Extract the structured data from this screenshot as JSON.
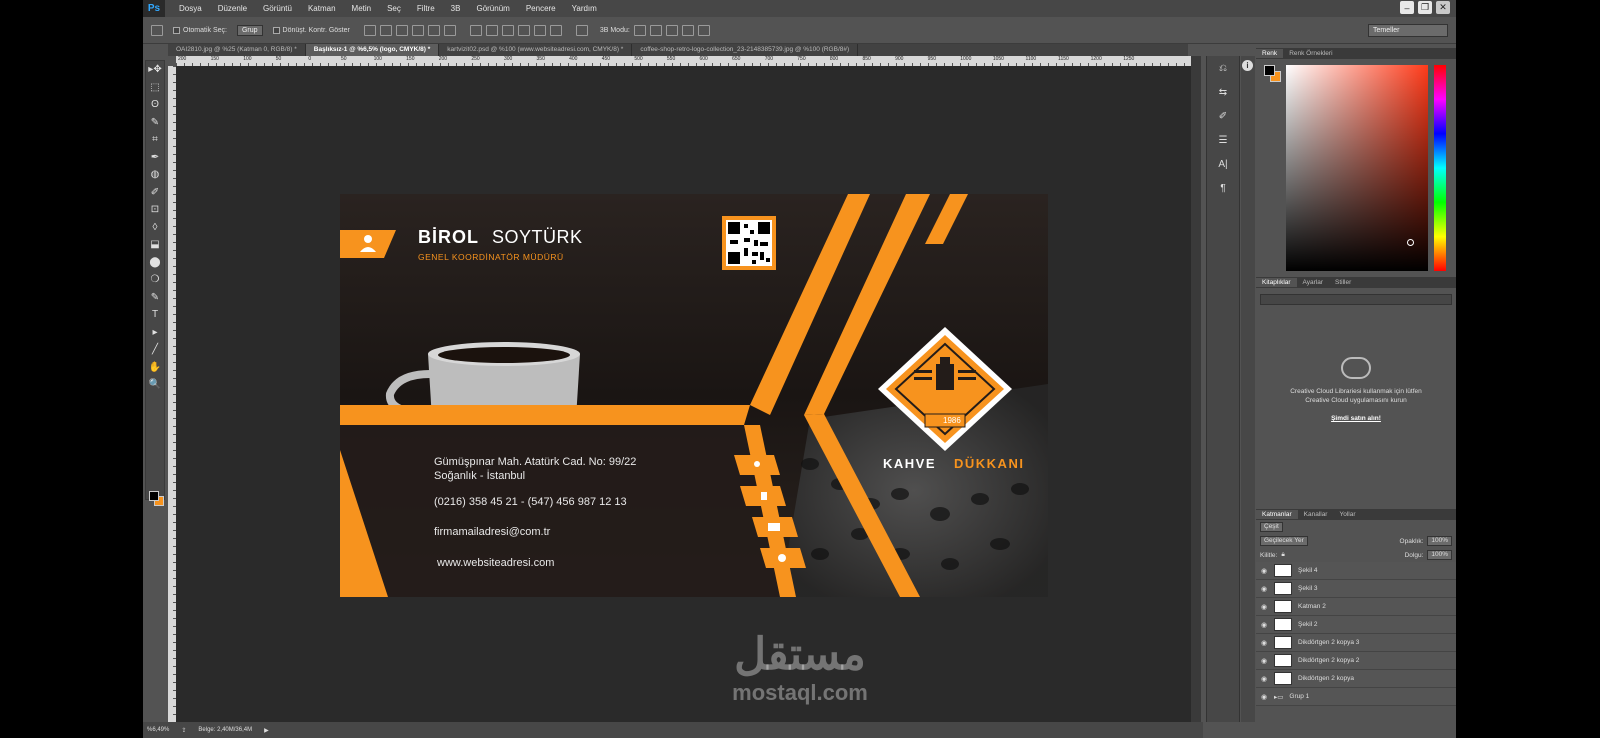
{
  "app": {
    "logo": "Ps"
  },
  "menu": [
    "Dosya",
    "Düzenle",
    "Görüntü",
    "Katman",
    "Metin",
    "Seç",
    "Filtre",
    "3B",
    "Görünüm",
    "Pencere",
    "Yardım"
  ],
  "options": {
    "auto_select_label": "Otomatik Seç:",
    "auto_select_value": "Grup",
    "transform_label": "Dönüşt. Kontr. Göster",
    "mode_3d": "3B Modu:",
    "workspace": "Temeller"
  },
  "tabs": [
    {
      "label": "OAI2810.jpg @ %25 (Katman 0, RGB/8) *",
      "active": false
    },
    {
      "label": "Başlıksız-1 @ %6,5% (logo, CMYK/8) *",
      "active": true
    },
    {
      "label": "kartvizit02.psd @ %100 (www.websiteadresi.com, CMYK/8) *",
      "active": false
    },
    {
      "label": "coffee-shop-retro-logo-collection_23-2148385739.jpg @ %100 (RGB/8#)",
      "active": false
    }
  ],
  "ruler_ticks": [
    "200",
    "150",
    "100",
    "50",
    "0",
    "50",
    "100",
    "150",
    "200",
    "250",
    "300",
    "350",
    "400",
    "450",
    "500",
    "550",
    "600",
    "650",
    "700",
    "750",
    "800",
    "850",
    "900",
    "950",
    "1000",
    "1050",
    "1100",
    "1150",
    "1200",
    "1250"
  ],
  "tools": [
    "▸✥",
    "⬚",
    "ʘ",
    "✎",
    "⌗",
    "✒",
    "◍",
    "✐",
    "⊡",
    "◊",
    "⬓",
    "⬤",
    "❍",
    "✎",
    "T",
    "▸",
    "╱",
    "✋",
    "🔍"
  ],
  "status": {
    "zoom": "%6,49%",
    "doc": "Belge: 2,40M/36,4M"
  },
  "card": {
    "name_first": "BİROL",
    "name_last": "SOYTÜRK",
    "job_title": "GENEL KOORDİNATÖR MÜDÜRÜ",
    "address_line1": "Gümüşpınar Mah. Atatürk Cad. No: 99/22",
    "address_line2": "Soğanlık - İstanbul",
    "phone": "(0216) 358 45 21 - (547) 456 987 12 13",
    "email": "firmamailadresi@com.tr",
    "website": "www.websiteadresi.com",
    "brand_1": "KAHVE",
    "brand_2": "DÜKKANI",
    "logo_year": "1986",
    "accent_color": "#f7931e"
  },
  "panels": {
    "color_tabs": [
      "Renk",
      "Renk Örnekleri"
    ],
    "lib_tabs": [
      "Kitaplıklar",
      "Ayarlar",
      "Stiller"
    ],
    "lib_message": "Creative Cloud Librariesi kullanmak için lütfen Creative Cloud uygulamasını kurun",
    "lib_link": "Şimdi satın alın!",
    "layer_tabs": [
      "Katmanlar",
      "Kanallar",
      "Yollar"
    ],
    "kind_filter": "Çeşit",
    "blend_mode": "Geçilecek Yer",
    "opacity_label": "Opaklık:",
    "opacity_value": "100%",
    "lock_label": "Kilitle:",
    "fill_label": "Dolgu:",
    "fill_value": "100%",
    "layers": [
      "Şekil 4",
      "Şekil 3",
      "Katman 2",
      "Şekil 2",
      "Dikdörtgen 2 kopya 3",
      "Dikdörtgen 2 kopya 2",
      "Dikdörtgen 2 kopya",
      "Grup 1"
    ]
  },
  "watermark": {
    "arabic": "مستقل",
    "latin": "mostaql.com"
  }
}
